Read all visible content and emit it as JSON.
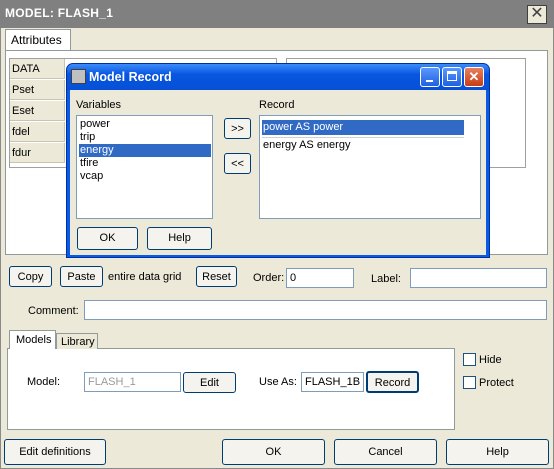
{
  "window": {
    "title": "MODEL: FLASH_1"
  },
  "tabs": {
    "attributes": "Attributes"
  },
  "grid": {
    "rows": [
      "DATA",
      "Pset",
      "Eset",
      "fdel",
      "fdur"
    ]
  },
  "dialog": {
    "title": "Model Record",
    "variables_label": "Variables",
    "record_label": "Record",
    "variables": [
      "power",
      "trip",
      "energy",
      "tfire",
      "vcap"
    ],
    "selected_variable": "energy",
    "records": [
      "power AS power",
      "energy AS energy"
    ],
    "add_label": ">>",
    "remove_label": "<<",
    "ok_label": "OK",
    "help_label": "Help"
  },
  "toolbar": {
    "copy_label": "Copy",
    "paste_label": "Paste",
    "entire_grid_text": "entire data grid",
    "reset_label": "Reset",
    "order_label": "Order:",
    "order_value": "0",
    "label_label": "Label:",
    "label_value": ""
  },
  "comment": {
    "label": "Comment:",
    "value": ""
  },
  "models_panel": {
    "tab_models": "Models",
    "tab_library": "Library",
    "model_label": "Model:",
    "model_value": "FLASH_1",
    "edit_label": "Edit",
    "use_as_label": "Use As:",
    "use_as_value": "FLASH_1B",
    "record_label": "Record"
  },
  "options": {
    "hide_label": "Hide",
    "protect_label": "Protect",
    "hide_checked": false,
    "protect_checked": false
  },
  "footer": {
    "edit_definitions_label": "Edit definitions",
    "ok_label": "OK",
    "cancel_label": "Cancel",
    "help_label": "Help"
  }
}
